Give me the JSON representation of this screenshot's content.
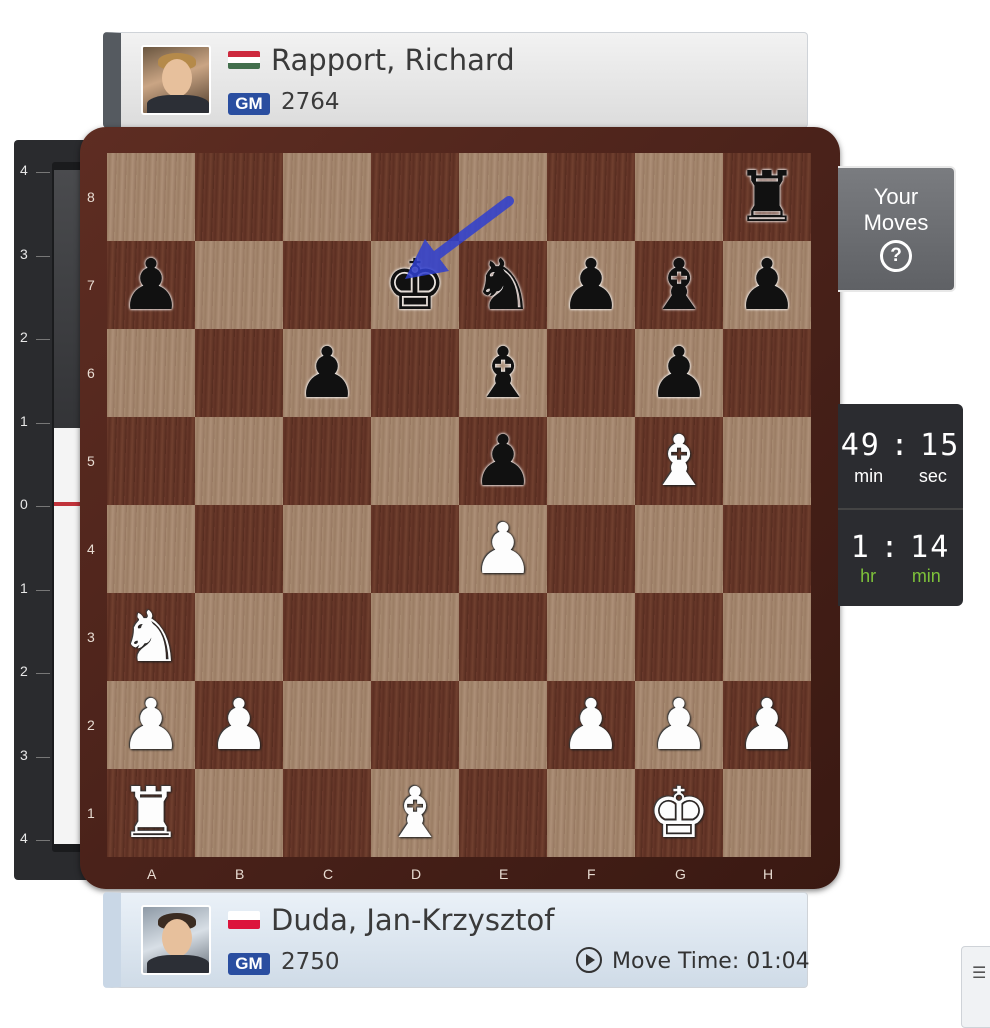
{
  "top_player": {
    "name": "Rapport, Richard",
    "title": "GM",
    "rating": "2764",
    "flag": "hungary-flag",
    "flag_colors": [
      "#cd2a3e",
      "#ffffff",
      "#436f4d"
    ]
  },
  "bottom_player": {
    "name": "Duda, Jan-Krzysztof",
    "title": "GM",
    "rating": "2750",
    "flag": "poland-flag",
    "flag_colors": [
      "#ffffff",
      "#dc143c"
    ],
    "move_time_label": "Move Time: 01:04"
  },
  "eval_bar": {
    "labels": [
      "4",
      "3",
      "2",
      "1",
      "0",
      "1",
      "2",
      "3",
      "4"
    ],
    "colors": {
      "black": "#3a3b3e",
      "white": "#f4f4f4",
      "marker": "#c0323a"
    }
  },
  "board": {
    "files": [
      "A",
      "B",
      "C",
      "D",
      "E",
      "F",
      "G",
      "H"
    ],
    "ranks": [
      "8",
      "7",
      "6",
      "5",
      "4",
      "3",
      "2",
      "1"
    ],
    "pieces": [
      {
        "square": "h8",
        "color": "black",
        "type": "rook"
      },
      {
        "square": "a7",
        "color": "black",
        "type": "pawn"
      },
      {
        "square": "d7",
        "color": "black",
        "type": "king"
      },
      {
        "square": "e7",
        "color": "black",
        "type": "knight"
      },
      {
        "square": "f7",
        "color": "black",
        "type": "pawn"
      },
      {
        "square": "g7",
        "color": "black",
        "type": "bishop"
      },
      {
        "square": "h7",
        "color": "black",
        "type": "pawn"
      },
      {
        "square": "c6",
        "color": "black",
        "type": "pawn"
      },
      {
        "square": "e6",
        "color": "black",
        "type": "bishop"
      },
      {
        "square": "g6",
        "color": "black",
        "type": "pawn"
      },
      {
        "square": "e5",
        "color": "black",
        "type": "pawn"
      },
      {
        "square": "g5",
        "color": "white",
        "type": "bishop"
      },
      {
        "square": "e4",
        "color": "white",
        "type": "pawn"
      },
      {
        "square": "a3",
        "color": "white",
        "type": "knight"
      },
      {
        "square": "a2",
        "color": "white",
        "type": "pawn"
      },
      {
        "square": "b2",
        "color": "white",
        "type": "pawn"
      },
      {
        "square": "f2",
        "color": "white",
        "type": "pawn"
      },
      {
        "square": "g2",
        "color": "white",
        "type": "pawn"
      },
      {
        "square": "h2",
        "color": "white",
        "type": "pawn"
      },
      {
        "square": "a1",
        "color": "white",
        "type": "rook"
      },
      {
        "square": "d1",
        "color": "white",
        "type": "bishop"
      },
      {
        "square": "g1",
        "color": "white",
        "type": "king"
      }
    ],
    "arrow": {
      "from": "e8",
      "to": "d7",
      "color": "#2f3fd0"
    }
  },
  "your_moves": {
    "line1": "Your",
    "line2": "Moves",
    "help_glyph": "?"
  },
  "timer": {
    "main_value_left": "49",
    "main_sep": ":",
    "main_value_right": "15",
    "main_unit_left": "min",
    "main_unit_right": "sec",
    "total_value_left": "1",
    "total_sep": ":",
    "total_value_right": "14",
    "total_unit_left": "hr",
    "total_unit_right": "min",
    "accent": "#7dc13a"
  },
  "corner_widget": {
    "icon": "list-icon"
  }
}
